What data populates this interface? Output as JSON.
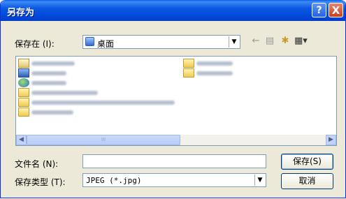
{
  "window": {
    "title": "另存为"
  },
  "title_buttons": {
    "help": "?",
    "close": "X"
  },
  "save_in": {
    "label": "保存在 (I):",
    "value": "桌面"
  },
  "file_items": [
    {
      "type": "doc"
    },
    {
      "type": "computer"
    },
    {
      "type": "network"
    },
    {
      "type": "folder"
    },
    {
      "type": "folder"
    },
    {
      "type": "folder"
    },
    {
      "type": "folder"
    },
    {
      "type": "folder"
    }
  ],
  "filename": {
    "label": "文件名 (N):",
    "value": ""
  },
  "filetype": {
    "label": "保存类型 (T):",
    "value": "JPEG (*.jpg)"
  },
  "buttons": {
    "save": "保存(S)",
    "cancel": "取消"
  },
  "scrollbar": {
    "thumb_grip": "III"
  }
}
